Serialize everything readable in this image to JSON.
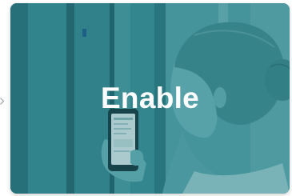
{
  "card": {
    "label": "Enable",
    "overlay_color": "#1f6f7a"
  },
  "nav": {
    "prev_icon": "chevron-right-icon"
  }
}
